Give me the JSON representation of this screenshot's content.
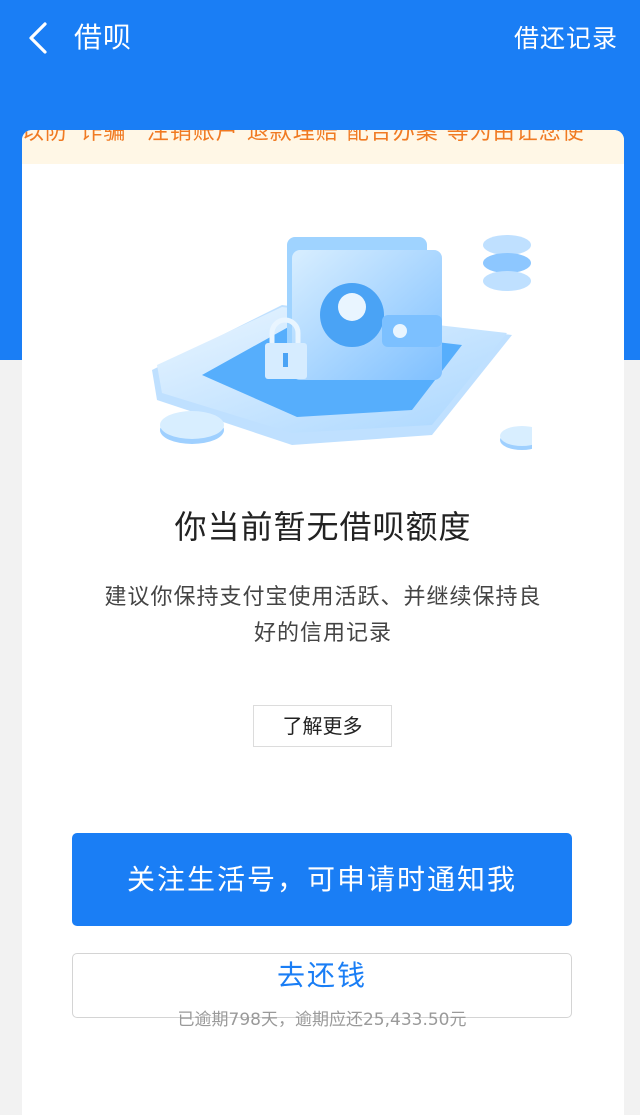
{
  "nav": {
    "title": "借呗",
    "records_link": "借还记录",
    "back_icon": "chevron-left-icon"
  },
  "notice": {
    "text": "以防“诈骗” 注销账户 退款理赔 配合办案 等为由让您使"
  },
  "empty_state": {
    "title": "你当前暂无借呗额度",
    "description": "建议你保持支付宝使用活跃、并继续保持良好的信用记录",
    "learn_more": "了解更多",
    "illustration": "wallet-phone-illustration"
  },
  "actions": {
    "follow_label": "关注生活号，可申请时通知我",
    "repay_label": "去还钱",
    "repay_detail": "已逾期798天，逾期应还25,433.50元"
  },
  "colors": {
    "primary": "#1a7ef5",
    "notice_text": "#f07a22",
    "notice_bg": "#fff7e6"
  }
}
